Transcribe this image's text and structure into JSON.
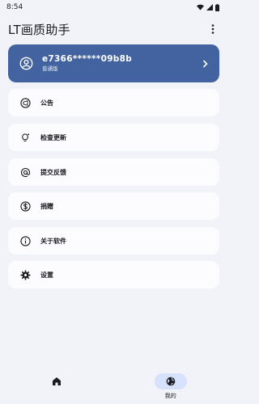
{
  "status_bar": {
    "time": "8:54"
  },
  "app_bar": {
    "title": "LT画质助手"
  },
  "account": {
    "id": "e7366******09b8b",
    "type": "普通版"
  },
  "menu": [
    {
      "label": "公告",
      "icon": "megaphone-icon"
    },
    {
      "label": "检查更新",
      "icon": "lightbulb-icon"
    },
    {
      "label": "提交反馈",
      "icon": "at-sign-icon"
    },
    {
      "label": "捐赠",
      "icon": "dollar-icon"
    },
    {
      "label": "关于软件",
      "icon": "info-icon"
    },
    {
      "label": "设置",
      "icon": "gear-icon"
    }
  ],
  "bottom_nav": [
    {
      "label": "",
      "icon": "home-icon",
      "active": false
    },
    {
      "label": "我的",
      "icon": "globe-icon",
      "active": true
    }
  ],
  "colors": {
    "accent": "#42639f",
    "active_pill": "#d6e2fb",
    "background": "#f1f3f8",
    "card": "#fcfcff"
  }
}
